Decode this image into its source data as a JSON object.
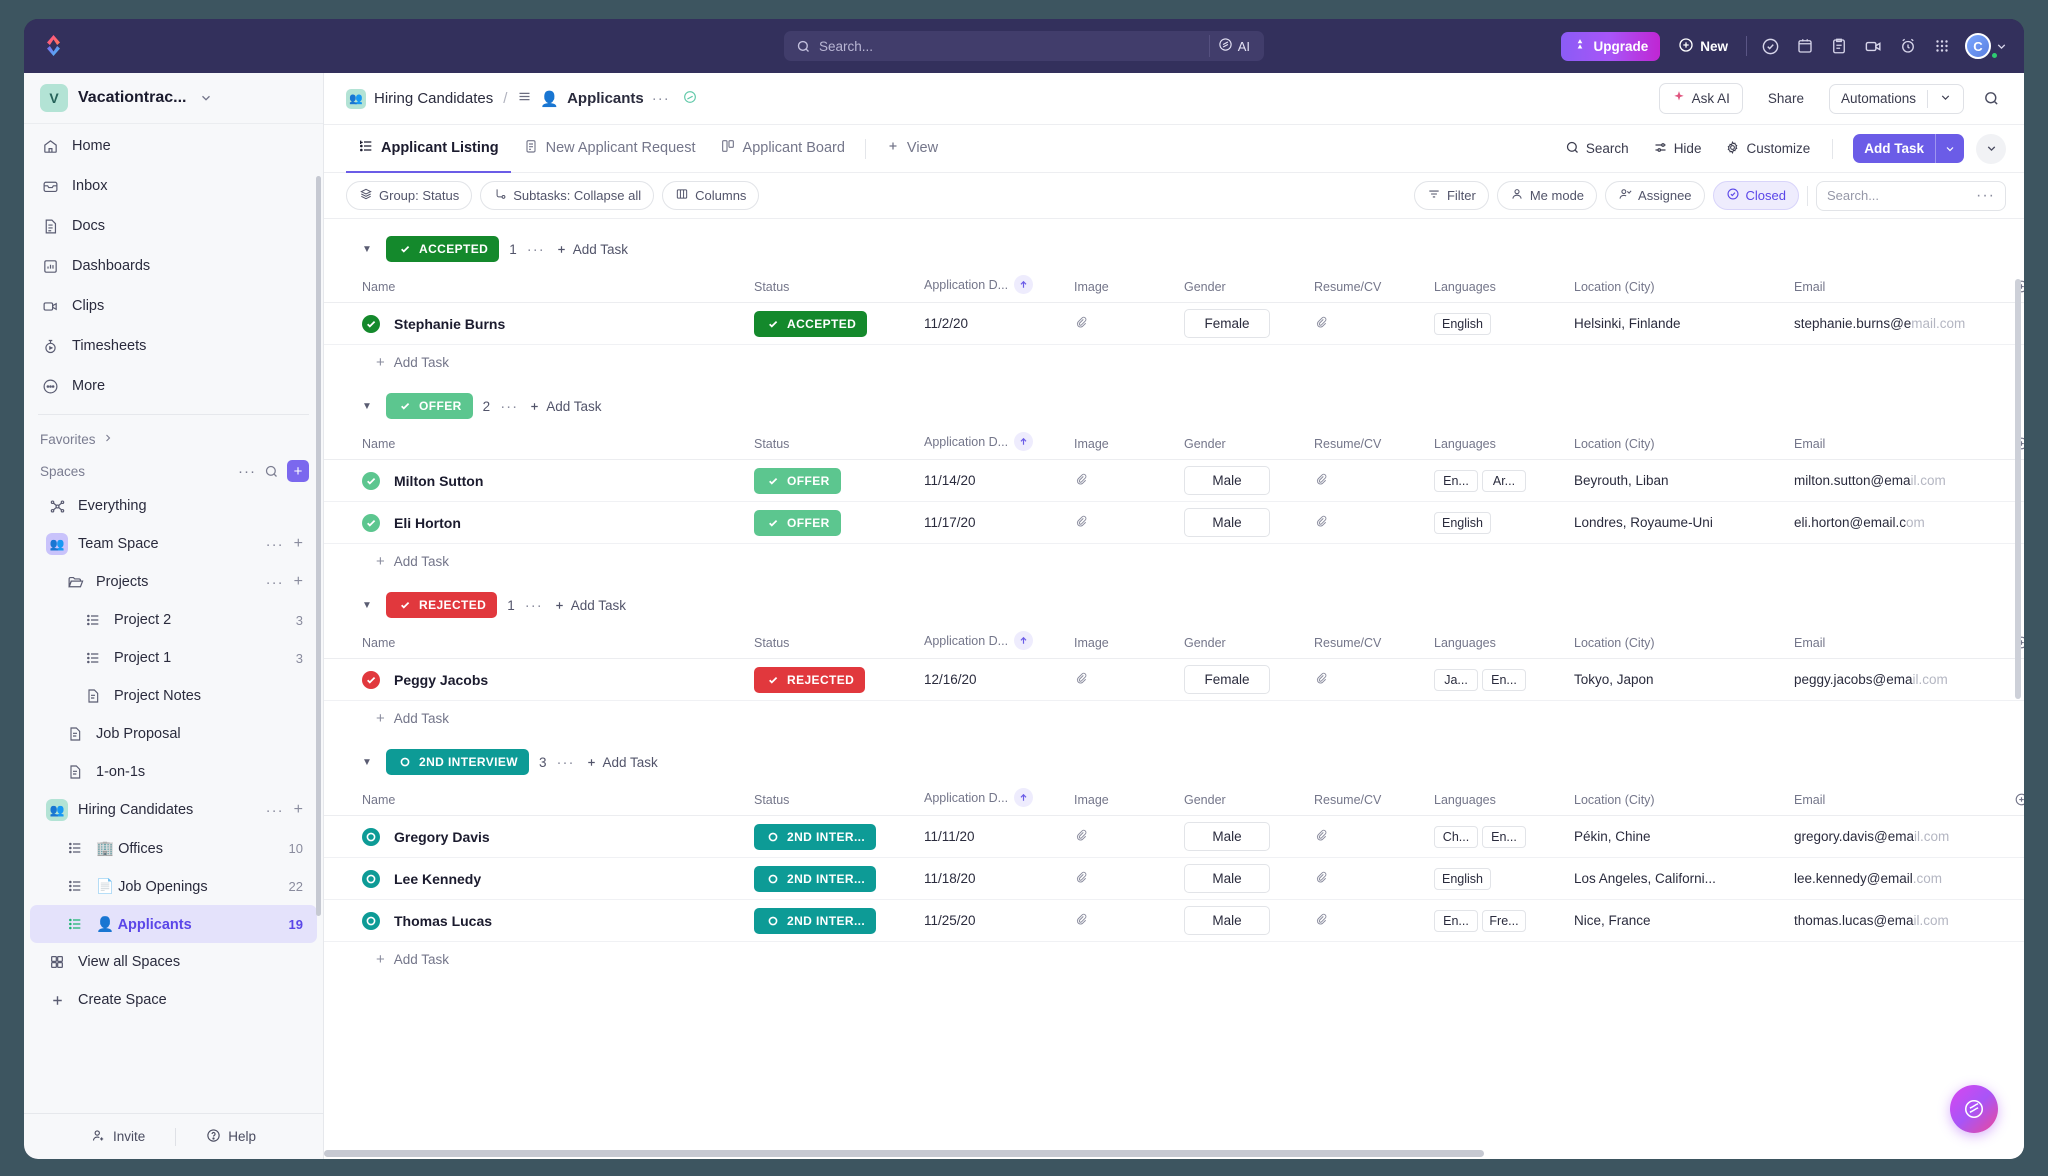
{
  "topbar": {
    "logo_name": "clickup-logo",
    "search_placeholder": "Search...",
    "ai_label": "AI",
    "upgrade_label": "Upgrade",
    "new_label": "New",
    "icons": [
      "check-circle-icon",
      "calendar-icon",
      "clipboard-icon",
      "video-icon",
      "alarm-clock-icon",
      "app-grid-icon"
    ],
    "avatar_initial": "C"
  },
  "sidebar": {
    "workspace": {
      "badge": "V",
      "name": "Vacationtrac..."
    },
    "nav": [
      {
        "label": "Home",
        "icon": "home-icon"
      },
      {
        "label": "Inbox",
        "icon": "inbox-icon"
      },
      {
        "label": "Docs",
        "icon": "docs-icon"
      },
      {
        "label": "Dashboards",
        "icon": "dashboards-icon"
      },
      {
        "label": "Clips",
        "icon": "clips-icon"
      },
      {
        "label": "Timesheets",
        "icon": "timesheets-icon"
      },
      {
        "label": "More",
        "icon": "more-icon"
      }
    ],
    "favorites_label": "Favorites",
    "spaces_label": "Spaces",
    "tree": [
      {
        "label": "Everything",
        "icon": "everything-icon",
        "level": 0,
        "kind": "everything"
      },
      {
        "label": "Team Space",
        "icon": "team-space-icon",
        "level": 0,
        "kind": "space",
        "dots": true,
        "plus": true
      },
      {
        "label": "Projects",
        "icon": "folder-icon",
        "level": 1,
        "kind": "folder",
        "dots": true,
        "plus": true
      },
      {
        "label": "Project 2",
        "icon": "list-icon",
        "level": 2,
        "kind": "list",
        "count": "3"
      },
      {
        "label": "Project 1",
        "icon": "list-icon",
        "level": 2,
        "kind": "list",
        "count": "3"
      },
      {
        "label": "Project Notes",
        "icon": "doc-icon",
        "level": 2,
        "kind": "doc"
      },
      {
        "label": "Job Proposal",
        "icon": "doc-icon",
        "level": 1,
        "kind": "doc"
      },
      {
        "label": "1-on-1s",
        "icon": "doc-icon",
        "level": 1,
        "kind": "doc"
      },
      {
        "label": "Hiring Candidates",
        "icon": "hiring-space-icon",
        "level": 0,
        "kind": "space",
        "dots": true,
        "plus": true
      },
      {
        "label": "Offices",
        "icon": "list-icon",
        "level": 1,
        "kind": "list",
        "emoji": "🏢",
        "count": "10"
      },
      {
        "label": "Job Openings",
        "icon": "list-icon",
        "level": 1,
        "kind": "list",
        "emoji": "📄",
        "count": "22"
      },
      {
        "label": "Applicants",
        "icon": "list-icon",
        "level": 1,
        "kind": "list",
        "emoji": "👤",
        "count": "19",
        "selected": true
      }
    ],
    "view_all_spaces": "View all Spaces",
    "create_space": "Create Space",
    "footer": {
      "invite": "Invite",
      "help": "Help"
    }
  },
  "breadcrumb": {
    "space": "Hiring Candidates",
    "separator": "/",
    "list": "Applicants",
    "dots": "···",
    "actions": {
      "ask_ai": "Ask AI",
      "share": "Share",
      "automations": "Automations",
      "search_icon": "search-icon"
    }
  },
  "tabs": {
    "items": [
      {
        "label": "Applicant Listing",
        "icon": "list-view-icon",
        "active": true
      },
      {
        "label": "New Applicant Request",
        "icon": "form-view-icon",
        "active": false
      },
      {
        "label": "Applicant Board",
        "icon": "board-view-icon",
        "active": false
      }
    ],
    "add_view": "View",
    "right": {
      "search": "Search",
      "hide": "Hide",
      "customize": "Customize",
      "add_task": "Add Task"
    }
  },
  "filters": {
    "left": [
      {
        "label": "Group: Status",
        "icon": "layers-icon"
      },
      {
        "label": "Subtasks: Collapse all",
        "icon": "subtask-icon"
      },
      {
        "label": "Columns",
        "icon": "columns-icon"
      }
    ],
    "right": [
      {
        "label": "Filter",
        "icon": "filter-icon",
        "active": false
      },
      {
        "label": "Me mode",
        "icon": "person-icon",
        "active": false
      },
      {
        "label": "Assignee",
        "icon": "assignee-icon",
        "active": false
      },
      {
        "label": "Closed",
        "icon": "check-circle-icon",
        "active": true
      }
    ],
    "search_placeholder": "Search...",
    "more_dots": "···"
  },
  "table": {
    "columns": [
      {
        "key": "name",
        "label": "Name"
      },
      {
        "key": "status",
        "label": "Status"
      },
      {
        "key": "date",
        "label": "Application D...",
        "sorted": "asc"
      },
      {
        "key": "image",
        "label": "Image"
      },
      {
        "key": "gender",
        "label": "Gender"
      },
      {
        "key": "resume",
        "label": "Resume/CV"
      },
      {
        "key": "languages",
        "label": "Languages"
      },
      {
        "key": "location",
        "label": "Location (City)"
      },
      {
        "key": "email",
        "label": "Email"
      }
    ],
    "add_column_icon": "add-column-icon",
    "add_task_label": "Add Task",
    "groups": [
      {
        "status": "ACCEPTED",
        "color": "#14892c",
        "count": "1",
        "add_task": "Add Task",
        "rows": [
          {
            "name": "Stephanie Burns",
            "status": "ACCEPTED",
            "status_color": "#14892c",
            "date": "11/2/20",
            "image": "attachment-icon",
            "gender": "Female",
            "resume": "attachment-icon",
            "languages": [
              "English"
            ],
            "location": "Helsinki, Finlande",
            "email": "stephanie.burns@e",
            "email_dim": "mail.com"
          }
        ]
      },
      {
        "status": "OFFER",
        "color": "#5cc68f",
        "count": "2",
        "add_task": "Add Task",
        "rows": [
          {
            "name": "Milton Sutton",
            "status": "OFFER",
            "status_color": "#5cc68f",
            "date": "11/14/20",
            "image": "attachment-icon",
            "gender": "Male",
            "resume": "attachment-icon",
            "languages": [
              "En...",
              "Ar..."
            ],
            "location": "Beyrouth, Liban",
            "email": "milton.sutton@ema",
            "email_dim": "il.com"
          },
          {
            "name": "Eli Horton",
            "status": "OFFER",
            "status_color": "#5cc68f",
            "date": "11/17/20",
            "image": "attachment-icon",
            "gender": "Male",
            "resume": "attachment-icon",
            "languages": [
              "English"
            ],
            "location": "Londres, Royaume-Uni",
            "email": "eli.horton@email.c",
            "email_dim": "om"
          }
        ]
      },
      {
        "status": "REJECTED",
        "color": "#e1383d",
        "count": "1",
        "add_task": "Add Task",
        "rows": [
          {
            "name": "Peggy Jacobs",
            "status": "REJECTED",
            "status_color": "#e1383d",
            "date": "12/16/20",
            "image": "attachment-icon",
            "gender": "Female",
            "resume": "attachment-icon",
            "languages": [
              "Ja...",
              "En..."
            ],
            "location": "Tokyo, Japon",
            "email": "peggy.jacobs@ema",
            "email_dim": "il.com"
          }
        ]
      },
      {
        "status": "2ND INTERVIEW",
        "color": "#0d9b96",
        "count": "3",
        "add_task": "Add Task",
        "rows": [
          {
            "name": "Gregory Davis",
            "status": "2ND INTER...",
            "status_color": "#0d9b96",
            "date": "11/11/20",
            "image": "attachment-icon",
            "gender": "Male",
            "resume": "attachment-icon",
            "languages": [
              "Ch...",
              "En..."
            ],
            "location": "Pékin, Chine",
            "email": "gregory.davis@ema",
            "email_dim": "il.com"
          },
          {
            "name": "Lee Kennedy",
            "status": "2ND INTER...",
            "status_color": "#0d9b96",
            "date": "11/18/20",
            "image": "attachment-icon",
            "gender": "Male",
            "resume": "attachment-icon",
            "languages": [
              "English"
            ],
            "location": "Los Angeles, Californi...",
            "email": "lee.kennedy@email",
            "email_dim": ".com"
          },
          {
            "name": "Thomas Lucas",
            "status": "2ND INTER...",
            "status_color": "#0d9b96",
            "date": "11/25/20",
            "image": "attachment-icon",
            "gender": "Male",
            "resume": "attachment-icon",
            "languages": [
              "En...",
              "Fre..."
            ],
            "location": "Nice, France",
            "email": "thomas.lucas@ema",
            "email_dim": "il.com"
          }
        ]
      }
    ]
  },
  "fab": {
    "icon": "ai-sparkle-icon"
  },
  "colors": {
    "accent": "#6b5ce7",
    "topbar": "#33305c",
    "accepted": "#14892c",
    "offer": "#5cc68f",
    "rejected": "#e1383d",
    "second_interview": "#0d9b96"
  }
}
